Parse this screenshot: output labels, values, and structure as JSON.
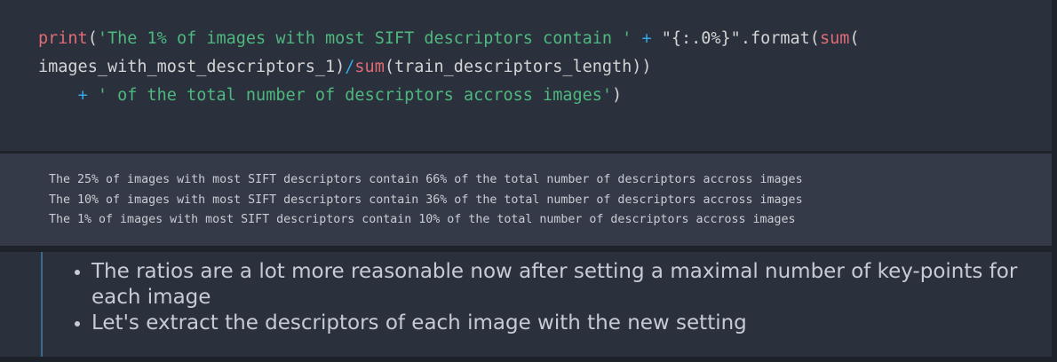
{
  "code": {
    "line1": {
      "print": "print",
      "paren_open": "(",
      "string1": "'The 1% of images with most SIFT descriptors contain '",
      "plus": "+",
      "format_str": "\"{:.0%}\"",
      "format_call": ".format(",
      "sum1": "sum",
      "paren_after_sum": "("
    },
    "line2": {
      "arg1": "images_with_most_descriptors_1)",
      "slash": "/",
      "sum2": "sum",
      "arg2": "(train_descriptors_length))"
    },
    "line3": {
      "indent": "    ",
      "plus": "+",
      "string2": "' of the total number of descriptors accross images'",
      "close": ")"
    }
  },
  "output": {
    "lines": [
      "The 25% of images with most SIFT descriptors contain 66% of the total number of descriptors accross images",
      "The 10% of images with most SIFT descriptors contain 36% of the total number of descriptors accross images",
      "The 1% of images with most SIFT descriptors contain 10% of the total number of descriptors accross images"
    ]
  },
  "markdown": {
    "bullets": [
      "The ratios are a lot more reasonable now after setting a maximal number of key-points for each image",
      "Let's extract the descriptors of each image with the new setting"
    ]
  },
  "colors": {
    "function": "#e06c75",
    "string": "#4fb87f",
    "operator": "#35a9e6"
  }
}
